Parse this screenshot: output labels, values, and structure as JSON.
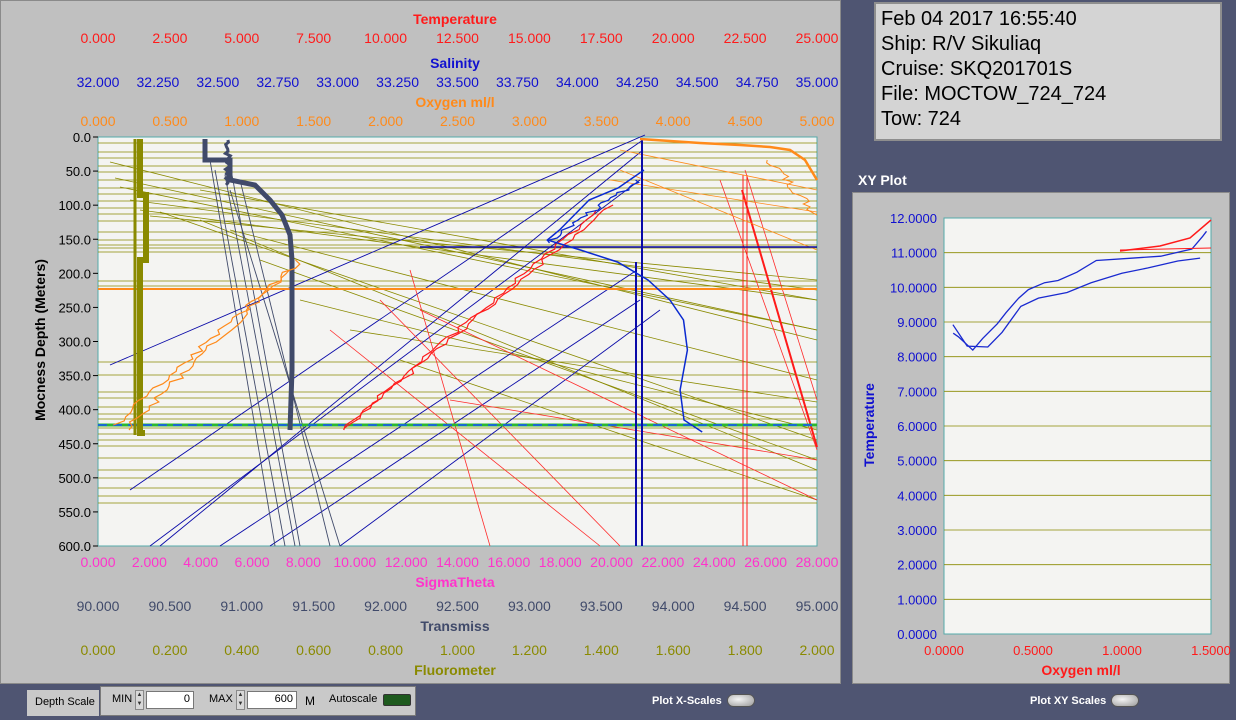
{
  "info": {
    "datetime": "Feb 04 2017 16:55:40",
    "ship": "Ship: R/V Sikuliaq",
    "cruise": "Cruise: SKQ201701S",
    "file": "File: MOCTOW_724_724",
    "tow": "Tow: 724"
  },
  "main_plot": {
    "y_axis_label": "Mocness Depth (Meters)",
    "y_ticks": [
      "0.0",
      "50.0",
      "100.0",
      "150.0",
      "200.0",
      "250.0",
      "300.0",
      "350.0",
      "400.0",
      "450.0",
      "500.0",
      "550.0",
      "600.0"
    ],
    "top_axes": [
      {
        "name": "Temperature",
        "color": "#ff1a1a",
        "ticks": [
          "0.000",
          "2.500",
          "5.000",
          "7.500",
          "10.000",
          "12.500",
          "15.000",
          "17.500",
          "20.000",
          "22.500",
          "25.000"
        ]
      },
      {
        "name": "Salinity",
        "color": "#1010d0",
        "ticks": [
          "32.000",
          "32.250",
          "32.500",
          "32.750",
          "33.000",
          "33.250",
          "33.500",
          "33.750",
          "34.000",
          "34.250",
          "34.500",
          "34.750",
          "35.000"
        ]
      },
      {
        "name": "Oxygen ml/l",
        "color": "#ff8a1a",
        "ticks": [
          "0.000",
          "0.500",
          "1.000",
          "1.500",
          "2.000",
          "2.500",
          "3.000",
          "3.500",
          "4.000",
          "4.500",
          "5.000"
        ]
      }
    ],
    "bottom_axes": [
      {
        "name": "SigmaTheta",
        "color": "#ff33cc",
        "ticks": [
          "0.000",
          "2.000",
          "4.000",
          "6.000",
          "8.000",
          "10.000",
          "12.000",
          "14.000",
          "16.000",
          "18.000",
          "20.000",
          "22.000",
          "24.000",
          "26.000",
          "28.000"
        ]
      },
      {
        "name": "Transmiss",
        "color": "#404a6a",
        "ticks": [
          "90.000",
          "90.500",
          "91.000",
          "91.500",
          "92.000",
          "92.500",
          "93.000",
          "93.500",
          "94.000",
          "94.500",
          "95.000"
        ]
      },
      {
        "name": "Fluorometer",
        "color": "#8a8a00",
        "ticks": [
          "0.000",
          "0.200",
          "0.400",
          "0.600",
          "0.800",
          "1.000",
          "1.200",
          "1.400",
          "1.600",
          "1.800",
          "2.000"
        ]
      }
    ]
  },
  "xy_plot": {
    "title": "XY Plot",
    "y_label": "Temperature",
    "x_label": "Oxygen ml/l",
    "y_ticks": [
      "0.0000",
      "1.0000",
      "2.0000",
      "3.0000",
      "4.0000",
      "5.0000",
      "6.0000",
      "7.0000",
      "8.0000",
      "9.0000",
      "10.0000",
      "11.0000",
      "12.0000"
    ],
    "x_ticks": [
      "0.0000",
      "0.5000",
      "1.0000",
      "1.5000"
    ]
  },
  "controls": {
    "depth_scale_label": "Depth Scale",
    "min_label": "MIN",
    "min_value": "0",
    "max_label": "MAX",
    "max_value": "600",
    "unit": "M",
    "autoscale_label": "Autoscale",
    "plot_x_scales_label": "Plot X-Scales",
    "plot_xy_scales_label": "Plot XY Scales"
  }
}
